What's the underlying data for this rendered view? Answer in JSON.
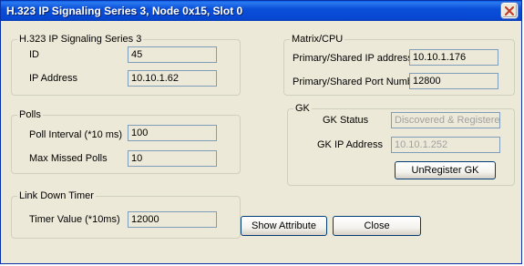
{
  "window": {
    "title": "H.323 IP Signaling Series 3,   Node  0x15, Slot 0"
  },
  "h323_group": {
    "legend": "H.323 IP Signaling Series 3",
    "id_label": "ID",
    "id_value": "45",
    "ip_label": "IP Address",
    "ip_value": "10.10.1.62"
  },
  "polls_group": {
    "legend": "Polls",
    "interval_label": "Poll Interval (*10 ms)",
    "interval_value": "100",
    "missed_label": "Max Missed Polls",
    "missed_value": "10"
  },
  "link_group": {
    "legend": "Link Down Timer",
    "timer_label": "Timer Value (*10ms)",
    "timer_value": "12000"
  },
  "matrix_group": {
    "legend": "Matrix/CPU",
    "ip_label": "Primary/Shared IP address",
    "ip_value": "10.10.1.176",
    "port_label": "Primary/Shared Port Number",
    "port_value": "12800"
  },
  "gk_group": {
    "legend": "GK",
    "status_label": "GK Status",
    "status_value": "Discovered & Registered",
    "ip_label": "GK IP Address",
    "ip_value": "10.10.1.252",
    "unregister_label": "UnRegister GK"
  },
  "buttons": {
    "show_attribute": "Show Attribute",
    "close": "Close"
  },
  "icons": {
    "close": "close-icon"
  }
}
